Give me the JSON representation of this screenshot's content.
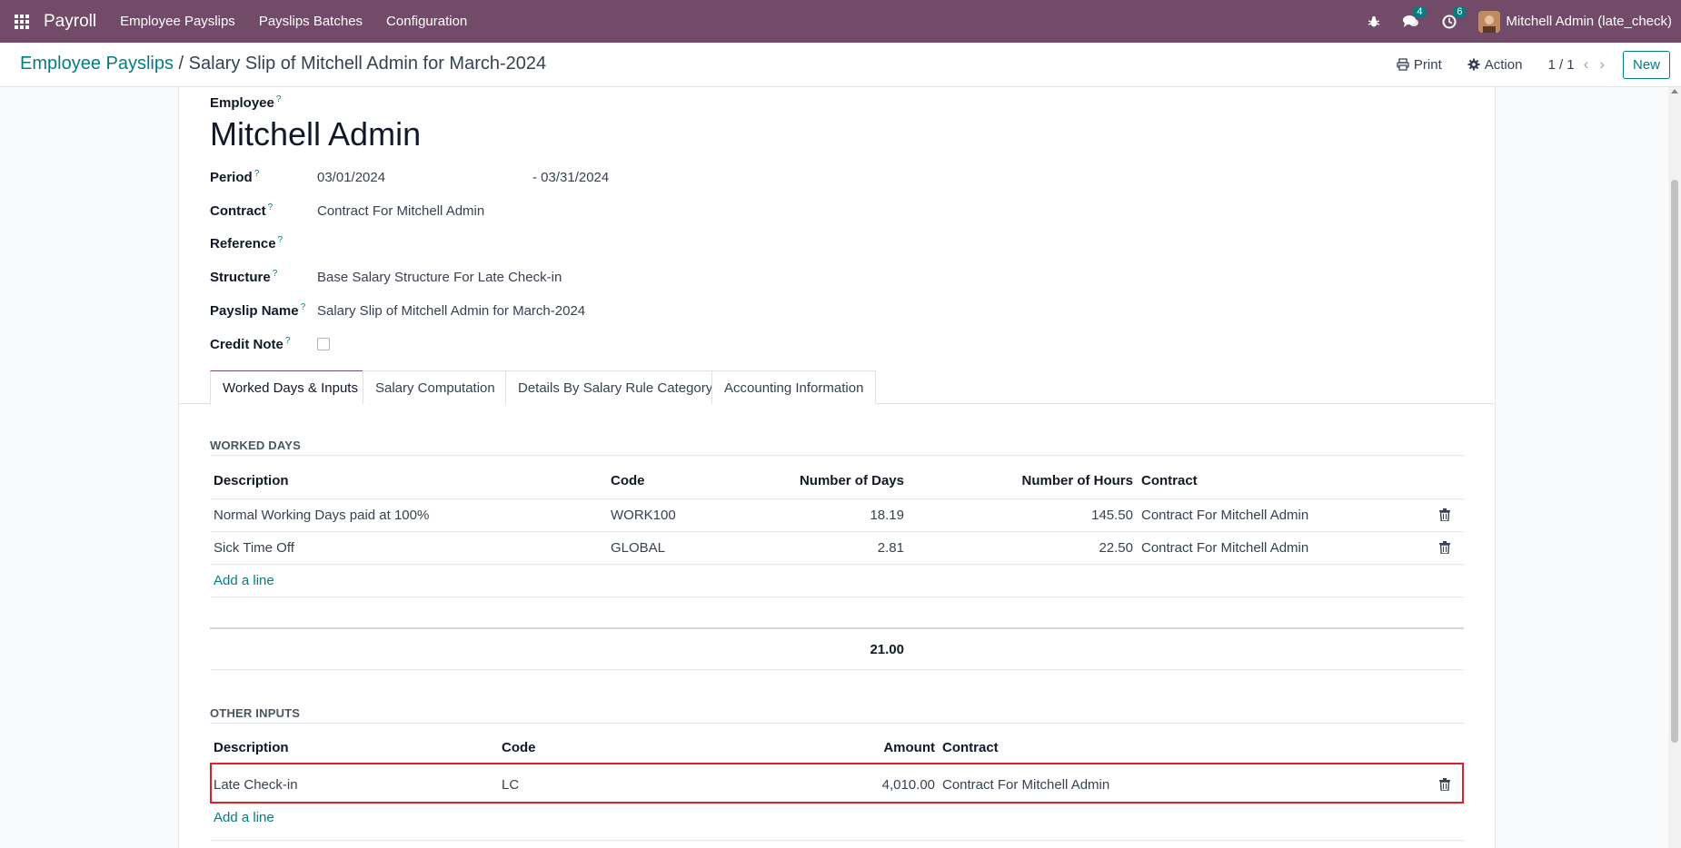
{
  "navbar": {
    "app_name": "Payroll",
    "menus": [
      "Employee Payslips",
      "Payslips Batches",
      "Configuration"
    ],
    "messages_count": "4",
    "activities_count": "6",
    "user": "Mitchell Admin (late_check)"
  },
  "control_panel": {
    "breadcrumb_parent": "Employee Payslips",
    "breadcrumb_sep": "/",
    "breadcrumb_current": "Salary Slip of Mitchell Admin for March-2024",
    "print_label": "Print",
    "action_label": "Action",
    "pager": "1 / 1",
    "new_label": "New"
  },
  "form": {
    "employee_label": "Employee",
    "employee_name": "Mitchell Admin",
    "help_mark": "?",
    "period_label": "Period",
    "period_from": "03/01/2024",
    "period_to": "- 03/31/2024",
    "contract_label": "Contract",
    "contract_value": "Contract For Mitchell Admin",
    "reference_label": "Reference",
    "structure_label": "Structure",
    "structure_value": "Base Salary Structure For Late Check-in",
    "payslip_name_label": "Payslip Name",
    "payslip_name_value": "Salary Slip of Mitchell Admin for March-2024",
    "credit_note_label": "Credit Note",
    "credit_note_checked": false
  },
  "tabs": [
    "Worked Days & Inputs",
    "Salary Computation",
    "Details By Salary Rule Category",
    "Accounting Information"
  ],
  "worked_days": {
    "title": "WORKED DAYS",
    "columns": [
      "Description",
      "Code",
      "Number of Days",
      "Number of Hours",
      "Contract"
    ],
    "rows": [
      {
        "description": "Normal Working Days paid at 100%",
        "code": "WORK100",
        "days": "18.19",
        "hours": "145.50",
        "contract": "Contract For Mitchell Admin"
      },
      {
        "description": "Sick Time Off",
        "code": "GLOBAL",
        "days": "2.81",
        "hours": "22.50",
        "contract": "Contract For Mitchell Admin"
      }
    ],
    "add_line": "Add a line",
    "total_days": "21.00"
  },
  "other_inputs": {
    "title": "OTHER INPUTS",
    "columns": [
      "Description",
      "Code",
      "Amount",
      "Contract"
    ],
    "rows": [
      {
        "description": "Late Check-in",
        "code": "LC",
        "amount": "4,010.00",
        "contract": "Contract For Mitchell Admin"
      }
    ],
    "add_line": "Add a line"
  },
  "colors": {
    "brand": "#714b67",
    "accent": "#017e84",
    "highlight": "#e11d2a"
  }
}
